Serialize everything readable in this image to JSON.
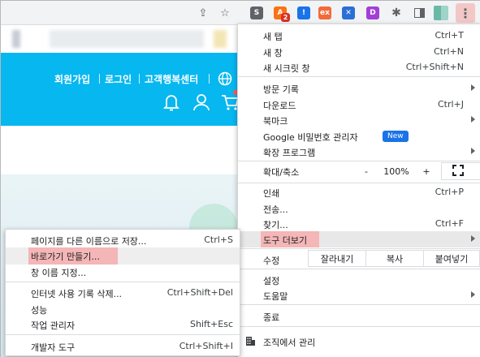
{
  "toolbar": {
    "extensions": [
      {
        "name": "s-extension",
        "glyph": "S",
        "color": "#5f6368"
      },
      {
        "name": "fox-extension",
        "glyph": "A",
        "color": "#f97316",
        "badge": "2"
      },
      {
        "name": "shield-extension",
        "glyph": "!",
        "color": "#1a73e8"
      },
      {
        "name": "ex-extension",
        "glyph": "ex",
        "color": "#f26b3a"
      },
      {
        "name": "x-extension",
        "glyph": "✕",
        "color": "#2b6fd6"
      },
      {
        "name": "d-extension",
        "glyph": "D",
        "color": "#a33fd6"
      }
    ]
  },
  "page": {
    "nav": {
      "signup": "회원가입",
      "login": "로그인",
      "support": "고객행복센터"
    }
  },
  "main_menu": {
    "items": [
      {
        "label": "새 탭",
        "shortcut": "Ctrl+T"
      },
      {
        "label": "새 창",
        "shortcut": "Ctrl+N"
      },
      {
        "label": "새 시크릿 창",
        "shortcut": "Ctrl+Shift+N"
      },
      {
        "label": "방문 기록",
        "shortcut": ""
      },
      {
        "label": "다운로드",
        "shortcut": "Ctrl+J"
      },
      {
        "label": "북마크",
        "shortcut": ""
      },
      {
        "label": "Google 비밀번호 관리자",
        "shortcut": ""
      },
      {
        "label": "확장 프로그램",
        "shortcut": ""
      },
      {
        "label": "인쇄",
        "shortcut": "Ctrl+P"
      },
      {
        "label": "전송...",
        "shortcut": ""
      },
      {
        "label": "찾기...",
        "shortcut": "Ctrl+F"
      },
      {
        "label": "도구 더보기",
        "shortcut": ""
      },
      {
        "label": "설정",
        "shortcut": ""
      },
      {
        "label": "도움말",
        "shortcut": ""
      },
      {
        "label": "종료",
        "shortcut": ""
      },
      {
        "label": "조직에서 관리",
        "shortcut": ""
      }
    ],
    "new_badge": "New",
    "zoom": {
      "label": "확대/축소",
      "minus": "-",
      "value": "100%",
      "plus": "+"
    },
    "edit": {
      "label": "수정",
      "cut": "잘라내기",
      "copy": "복사",
      "paste": "붙여넣기"
    }
  },
  "sub_menu": {
    "items": [
      {
        "label": "페이지를 다른 이름으로 저장...",
        "shortcut": "Ctrl+S"
      },
      {
        "label": "바로가기 만들기...",
        "shortcut": ""
      },
      {
        "label": "창 이름 지정...",
        "shortcut": ""
      },
      {
        "label": "인터넷 사용 기록 삭제...",
        "shortcut": "Ctrl+Shift+Del"
      },
      {
        "label": "성능",
        "shortcut": ""
      },
      {
        "label": "작업 관리자",
        "shortcut": "Shift+Esc"
      },
      {
        "label": "개발자 도구",
        "shortcut": "Ctrl+Shift+I"
      }
    ]
  }
}
